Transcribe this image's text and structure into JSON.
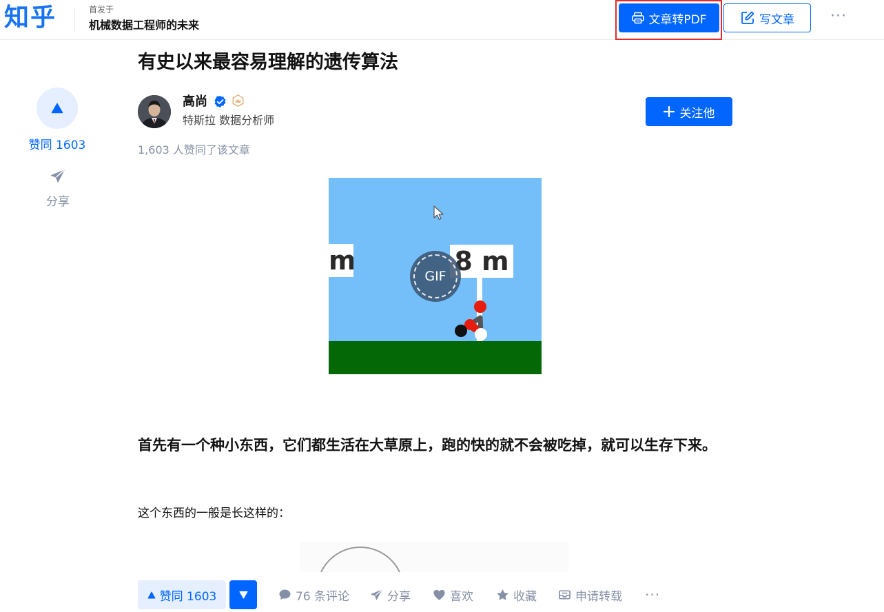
{
  "header": {
    "logo": "知乎",
    "published_in": "首发于",
    "column_name": "机械数据工程师的未来",
    "pdf_button": "文章转PDF",
    "write_button": "写文章",
    "more": "···"
  },
  "article": {
    "title": "有史以来最容易理解的遗传算法",
    "author": {
      "name": "高尚",
      "bio": "特斯拉 数据分析师"
    },
    "follow_button": "关注他",
    "vote_summary": "1,603 人赞同了该文章",
    "gif": {
      "badge": "GIF",
      "sign_left": "m",
      "sign_right": "8 m"
    },
    "para_bold": "首先有一个种小东西，它们都生活在大草原上，跑的快的就不会被吃掉，就可以生存下来。",
    "para": "这个东西的一般是长这样的："
  },
  "sidebar": {
    "vote_label": "赞同 1603",
    "share_label": "分享"
  },
  "bottom_bar": {
    "vote_label": "赞同 1603",
    "comments": "76 条评论",
    "share": "分享",
    "like": "喜欢",
    "collect": "收藏",
    "repost": "申请转载",
    "more": "···"
  },
  "colors": {
    "brand": "#0066ff",
    "highlight": "#e52b2b",
    "muted": "#8590a6"
  }
}
